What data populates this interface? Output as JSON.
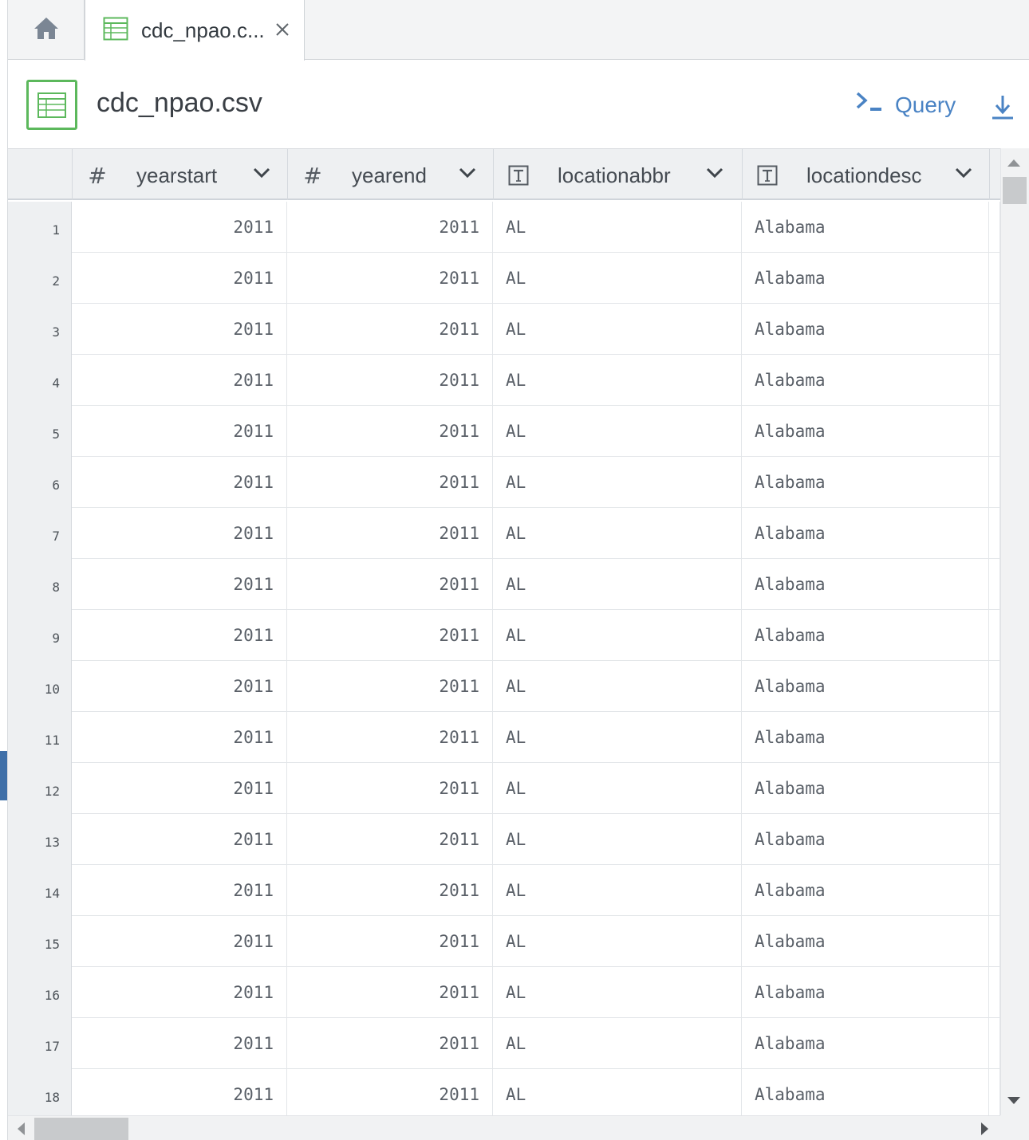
{
  "tabs": {
    "home_icon": "home-icon",
    "file_tab_label": "cdc_npao.c...",
    "file_tab_icon": "spreadsheet-icon",
    "close_icon": "close-icon"
  },
  "header": {
    "title": "cdc_npao.csv",
    "query_label": "Query",
    "query_icon": "terminal-prompt-icon",
    "download_icon": "download-icon"
  },
  "colors": {
    "accent": "#4a83c4",
    "file_icon_green": "#5cb85c",
    "side_marker": "#3f6fa8"
  },
  "columns": [
    {
      "name": "yearstart",
      "type_symbol": "#",
      "type": "number"
    },
    {
      "name": "yearend",
      "type_symbol": "#",
      "type": "number"
    },
    {
      "name": "locationabbr",
      "type_symbol": "T",
      "type": "text"
    },
    {
      "name": "locationdesc",
      "type_symbol": "T",
      "type": "text"
    }
  ],
  "rows": [
    {
      "n": "1",
      "cells": [
        "2011",
        "2011",
        "AL",
        "Alabama"
      ]
    },
    {
      "n": "2",
      "cells": [
        "2011",
        "2011",
        "AL",
        "Alabama"
      ]
    },
    {
      "n": "3",
      "cells": [
        "2011",
        "2011",
        "AL",
        "Alabama"
      ]
    },
    {
      "n": "4",
      "cells": [
        "2011",
        "2011",
        "AL",
        "Alabama"
      ]
    },
    {
      "n": "5",
      "cells": [
        "2011",
        "2011",
        "AL",
        "Alabama"
      ]
    },
    {
      "n": "6",
      "cells": [
        "2011",
        "2011",
        "AL",
        "Alabama"
      ]
    },
    {
      "n": "7",
      "cells": [
        "2011",
        "2011",
        "AL",
        "Alabama"
      ]
    },
    {
      "n": "8",
      "cells": [
        "2011",
        "2011",
        "AL",
        "Alabama"
      ]
    },
    {
      "n": "9",
      "cells": [
        "2011",
        "2011",
        "AL",
        "Alabama"
      ]
    },
    {
      "n": "10",
      "cells": [
        "2011",
        "2011",
        "AL",
        "Alabama"
      ]
    },
    {
      "n": "11",
      "cells": [
        "2011",
        "2011",
        "AL",
        "Alabama"
      ]
    },
    {
      "n": "12",
      "cells": [
        "2011",
        "2011",
        "AL",
        "Alabama"
      ]
    },
    {
      "n": "13",
      "cells": [
        "2011",
        "2011",
        "AL",
        "Alabama"
      ]
    },
    {
      "n": "14",
      "cells": [
        "2011",
        "2011",
        "AL",
        "Alabama"
      ]
    },
    {
      "n": "15",
      "cells": [
        "2011",
        "2011",
        "AL",
        "Alabama"
      ]
    },
    {
      "n": "16",
      "cells": [
        "2011",
        "2011",
        "AL",
        "Alabama"
      ]
    },
    {
      "n": "17",
      "cells": [
        "2011",
        "2011",
        "AL",
        "Alabama"
      ]
    },
    {
      "n": "18",
      "cells": [
        "2011",
        "2011",
        "AL",
        "Alabama"
      ]
    }
  ]
}
